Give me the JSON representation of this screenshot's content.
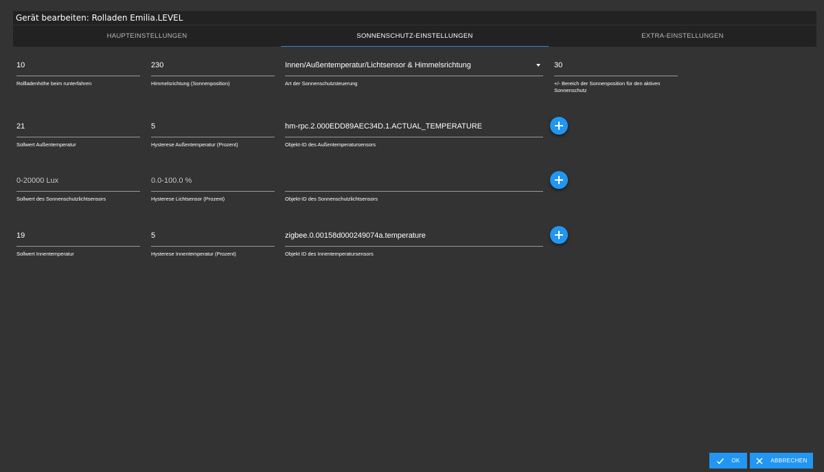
{
  "dialog": {
    "title": "Gerät bearbeiten: Rolladen Emilia.LEVEL"
  },
  "tabs": [
    {
      "label": "HAUPTEINSTELLUNGEN",
      "active": false
    },
    {
      "label": "SONNENSCHUTZ-EINSTELLUNGEN",
      "active": true
    },
    {
      "label": "EXTRA-EINSTELLUNGEN",
      "active": false
    }
  ],
  "rows": {
    "row1": {
      "height_value": "10",
      "height_label": "Rollladenhöhe beim runterfahren",
      "direction_value": "230",
      "direction_label": "Himmelsrichtung (Sonnenposition)",
      "type_value": "Innen/Außentemperatur/Lichtsensor & Himmelsrichtung",
      "type_label": "Art der Sonnenschutzsteuerung",
      "range_value": "30",
      "range_label": "+/- Bereich der Sonnenposition für den aktiven Sonnenschutz"
    },
    "row2": {
      "outside_temp_value": "21",
      "outside_temp_label": "Sollwert Außentemperatur",
      "outside_hyst_value": "5",
      "outside_hyst_label": "Hysterese Außentemperatur (Prozent)",
      "outside_id_value": "hm-rpc.2.000EDD89AEC34D.1.ACTUAL_TEMPERATURE",
      "outside_id_label": "Objekt-ID des Außentemperatursensors"
    },
    "row3": {
      "lux_placeholder": "0-20000 Lux",
      "lux_label": "Sollwert des Sonnenschutzlichtsensors",
      "light_hyst_placeholder": "0.0-100.0 %",
      "light_hyst_label": "Hysterese Lichtsensor (Prozent)",
      "light_id_value": "",
      "light_id_label": "Objekt-ID des Sonnenschutzlichtsensors"
    },
    "row4": {
      "inside_temp_value": "19",
      "inside_temp_label": "Sollwert Innentemperatur",
      "inside_hyst_value": "5",
      "inside_hyst_label": "Hysterese Innentemperatur (Prozent)",
      "inside_id_value": "zigbee.0.00158d000249074a.temperature",
      "inside_id_label": "Objekt ID des Innentemperatursensors"
    }
  },
  "icons": {
    "add": "plus-icon",
    "select_caret": "caret-down-icon",
    "ok": "check-icon",
    "cancel": "close-icon"
  },
  "footer": {
    "ok_label": "OK",
    "cancel_label": "ABBRECHEN"
  },
  "colors": {
    "accent": "#2196f3",
    "background": "#333333",
    "bar": "#222222"
  }
}
